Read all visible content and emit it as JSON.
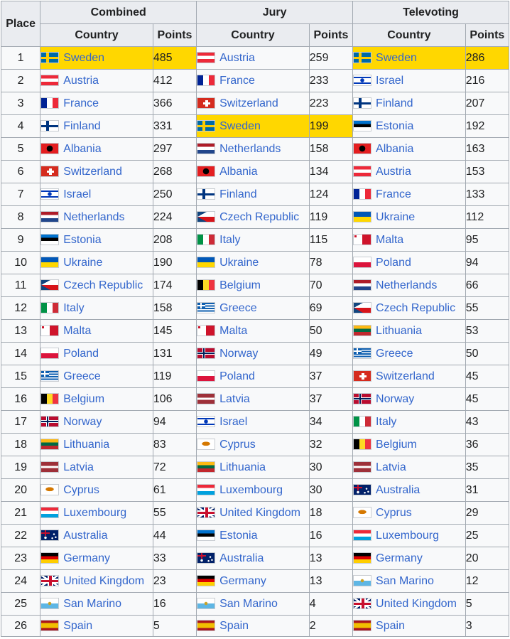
{
  "headers": {
    "place": "Place",
    "combined": "Combined",
    "jury": "Jury",
    "televoting": "Televoting",
    "country": "Country",
    "points": "Points"
  },
  "colors": {
    "highlight": "#ffd700",
    "link": "#3366cc",
    "header_bg": "#eaecf0",
    "border": "#a2a9b1"
  },
  "rows": [
    {
      "place": "1",
      "c": {
        "flag": "sweden",
        "country": "Sweden",
        "points": "485",
        "hl": true
      },
      "j": {
        "flag": "austria",
        "country": "Austria",
        "points": "259"
      },
      "t": {
        "flag": "sweden",
        "country": "Sweden",
        "points": "286",
        "hl": true
      }
    },
    {
      "place": "2",
      "c": {
        "flag": "austria",
        "country": "Austria",
        "points": "412"
      },
      "j": {
        "flag": "france",
        "country": "France",
        "points": "233"
      },
      "t": {
        "flag": "israel",
        "country": "Israel",
        "points": "216"
      }
    },
    {
      "place": "3",
      "c": {
        "flag": "france",
        "country": "France",
        "points": "366"
      },
      "j": {
        "flag": "switzerland",
        "country": "Switzerland",
        "points": "223"
      },
      "t": {
        "flag": "finland",
        "country": "Finland",
        "points": "207"
      }
    },
    {
      "place": "4",
      "c": {
        "flag": "finland",
        "country": "Finland",
        "points": "331"
      },
      "j": {
        "flag": "sweden",
        "country": "Sweden",
        "points": "199",
        "hl": true
      },
      "t": {
        "flag": "estonia",
        "country": "Estonia",
        "points": "192"
      }
    },
    {
      "place": "5",
      "c": {
        "flag": "albania",
        "country": "Albania",
        "points": "297"
      },
      "j": {
        "flag": "netherlands",
        "country": "Netherlands",
        "points": "158"
      },
      "t": {
        "flag": "albania",
        "country": "Albania",
        "points": "163"
      }
    },
    {
      "place": "6",
      "c": {
        "flag": "switzerland",
        "country": "Switzerland",
        "points": "268"
      },
      "j": {
        "flag": "albania",
        "country": "Albania",
        "points": "134"
      },
      "t": {
        "flag": "austria",
        "country": "Austria",
        "points": "153"
      }
    },
    {
      "place": "7",
      "c": {
        "flag": "israel",
        "country": "Israel",
        "points": "250"
      },
      "j": {
        "flag": "finland",
        "country": "Finland",
        "points": "124"
      },
      "t": {
        "flag": "france",
        "country": "France",
        "points": "133"
      }
    },
    {
      "place": "8",
      "c": {
        "flag": "netherlands",
        "country": "Netherlands",
        "points": "224"
      },
      "j": {
        "flag": "czech",
        "country": "Czech Republic",
        "points": "119"
      },
      "t": {
        "flag": "ukraine",
        "country": "Ukraine",
        "points": "112"
      }
    },
    {
      "place": "9",
      "c": {
        "flag": "estonia",
        "country": "Estonia",
        "points": "208"
      },
      "j": {
        "flag": "italy",
        "country": "Italy",
        "points": "115"
      },
      "t": {
        "flag": "malta",
        "country": "Malta",
        "points": "95"
      }
    },
    {
      "place": "10",
      "c": {
        "flag": "ukraine",
        "country": "Ukraine",
        "points": "190"
      },
      "j": {
        "flag": "ukraine",
        "country": "Ukraine",
        "points": "78"
      },
      "t": {
        "flag": "poland",
        "country": "Poland",
        "points": "94"
      }
    },
    {
      "place": "11",
      "c": {
        "flag": "czech",
        "country": "Czech Republic",
        "points": "174"
      },
      "j": {
        "flag": "belgium",
        "country": "Belgium",
        "points": "70"
      },
      "t": {
        "flag": "netherlands",
        "country": "Netherlands",
        "points": "66"
      }
    },
    {
      "place": "12",
      "c": {
        "flag": "italy",
        "country": "Italy",
        "points": "158"
      },
      "j": {
        "flag": "greece",
        "country": "Greece",
        "points": "69"
      },
      "t": {
        "flag": "czech",
        "country": "Czech Republic",
        "points": "55"
      }
    },
    {
      "place": "13",
      "c": {
        "flag": "malta",
        "country": "Malta",
        "points": "145"
      },
      "j": {
        "flag": "malta",
        "country": "Malta",
        "points": "50"
      },
      "t": {
        "flag": "lithuania",
        "country": "Lithuania",
        "points": "53"
      }
    },
    {
      "place": "14",
      "c": {
        "flag": "poland",
        "country": "Poland",
        "points": "131"
      },
      "j": {
        "flag": "norway",
        "country": "Norway",
        "points": "49"
      },
      "t": {
        "flag": "greece",
        "country": "Greece",
        "points": "50"
      }
    },
    {
      "place": "15",
      "c": {
        "flag": "greece",
        "country": "Greece",
        "points": "119"
      },
      "j": {
        "flag": "poland",
        "country": "Poland",
        "points": "37"
      },
      "t": {
        "flag": "switzerland",
        "country": "Switzerland",
        "points": "45"
      }
    },
    {
      "place": "16",
      "c": {
        "flag": "belgium",
        "country": "Belgium",
        "points": "106"
      },
      "j": {
        "flag": "latvia",
        "country": "Latvia",
        "points": "37"
      },
      "t": {
        "flag": "norway",
        "country": "Norway",
        "points": "45"
      }
    },
    {
      "place": "17",
      "c": {
        "flag": "norway",
        "country": "Norway",
        "points": "94"
      },
      "j": {
        "flag": "israel",
        "country": "Israel",
        "points": "34"
      },
      "t": {
        "flag": "italy",
        "country": "Italy",
        "points": "43"
      }
    },
    {
      "place": "18",
      "c": {
        "flag": "lithuania",
        "country": "Lithuania",
        "points": "83"
      },
      "j": {
        "flag": "cyprus",
        "country": "Cyprus",
        "points": "32"
      },
      "t": {
        "flag": "belgium",
        "country": "Belgium",
        "points": "36"
      }
    },
    {
      "place": "19",
      "c": {
        "flag": "latvia",
        "country": "Latvia",
        "points": "72"
      },
      "j": {
        "flag": "lithuania",
        "country": "Lithuania",
        "points": "30"
      },
      "t": {
        "flag": "latvia",
        "country": "Latvia",
        "points": "35"
      }
    },
    {
      "place": "20",
      "c": {
        "flag": "cyprus",
        "country": "Cyprus",
        "points": "61"
      },
      "j": {
        "flag": "luxembourg",
        "country": "Luxembourg",
        "points": "30"
      },
      "t": {
        "flag": "australia",
        "country": "Australia",
        "points": "31"
      }
    },
    {
      "place": "21",
      "c": {
        "flag": "luxembourg",
        "country": "Luxembourg",
        "points": "55"
      },
      "j": {
        "flag": "uk",
        "country": "United Kingdom",
        "points": "18"
      },
      "t": {
        "flag": "cyprus",
        "country": "Cyprus",
        "points": "29"
      }
    },
    {
      "place": "22",
      "c": {
        "flag": "australia",
        "country": "Australia",
        "points": "44"
      },
      "j": {
        "flag": "estonia",
        "country": "Estonia",
        "points": "16"
      },
      "t": {
        "flag": "luxembourg",
        "country": "Luxembourg",
        "points": "25"
      }
    },
    {
      "place": "23",
      "c": {
        "flag": "germany",
        "country": "Germany",
        "points": "33"
      },
      "j": {
        "flag": "australia",
        "country": "Australia",
        "points": "13"
      },
      "t": {
        "flag": "germany",
        "country": "Germany",
        "points": "20"
      }
    },
    {
      "place": "24",
      "c": {
        "flag": "uk",
        "country": "United Kingdom",
        "points": "23"
      },
      "j": {
        "flag": "germany",
        "country": "Germany",
        "points": "13"
      },
      "t": {
        "flag": "sanmarino",
        "country": "San Marino",
        "points": "12"
      }
    },
    {
      "place": "25",
      "c": {
        "flag": "sanmarino",
        "country": "San Marino",
        "points": "16"
      },
      "j": {
        "flag": "sanmarino",
        "country": "San Marino",
        "points": "4"
      },
      "t": {
        "flag": "uk",
        "country": "United Kingdom",
        "points": "5"
      }
    },
    {
      "place": "26",
      "c": {
        "flag": "spain",
        "country": "Spain",
        "points": "5"
      },
      "j": {
        "flag": "spain",
        "country": "Spain",
        "points": "2"
      },
      "t": {
        "flag": "spain",
        "country": "Spain",
        "points": "3"
      }
    }
  ]
}
